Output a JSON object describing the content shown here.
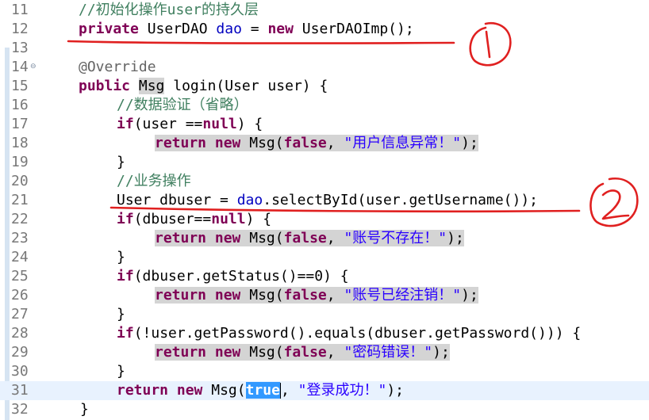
{
  "editor": {
    "lines": [
      {
        "num": "11",
        "segments": [
          {
            "t": "//初始化操作user的持久层",
            "c": "cm"
          }
        ]
      },
      {
        "num": "12",
        "segments": [
          {
            "t": "private",
            "c": "kw"
          },
          {
            "t": " UserDAO ",
            "c": ""
          },
          {
            "t": "dao",
            "c": "fd"
          },
          {
            "t": " = ",
            "c": ""
          },
          {
            "t": "new",
            "c": "kw"
          },
          {
            "t": " UserDAOImp();",
            "c": ""
          }
        ]
      },
      {
        "num": "13",
        "segments": []
      },
      {
        "num": "14",
        "fold": "⊖",
        "segments": [
          {
            "t": "@Override",
            "c": "an"
          }
        ]
      },
      {
        "num": "15",
        "segments": [
          {
            "t": "public",
            "c": "kw"
          },
          {
            "t": " ",
            "c": ""
          },
          {
            "t": "Msg",
            "c": "hl"
          },
          {
            "t": " login(User user) {",
            "c": ""
          }
        ]
      },
      {
        "num": "16",
        "segments": [
          {
            "t": "//数据验证（省略）",
            "c": "cm"
          }
        ]
      },
      {
        "num": "17",
        "segments": [
          {
            "t": "if",
            "c": "kw"
          },
          {
            "t": "(user ==",
            "c": ""
          },
          {
            "t": "null",
            "c": "kw"
          },
          {
            "t": ") {",
            "c": ""
          }
        ]
      },
      {
        "num": "18",
        "segments": [
          {
            "t": "return",
            "c": "kw hl"
          },
          {
            "t": " ",
            "c": "hl"
          },
          {
            "t": "new",
            "c": "kw hl"
          },
          {
            "t": " Msg(",
            "c": "hl"
          },
          {
            "t": "false",
            "c": "kw hl"
          },
          {
            "t": ", ",
            "c": "hl"
          },
          {
            "t": "\"用户信息异常！\"",
            "c": "st hl"
          },
          {
            "t": ");",
            "c": "hl"
          }
        ]
      },
      {
        "num": "19",
        "segments": [
          {
            "t": "}",
            "c": ""
          }
        ]
      },
      {
        "num": "20",
        "segments": [
          {
            "t": "//业务操作",
            "c": "cm"
          }
        ]
      },
      {
        "num": "21",
        "segments": [
          {
            "t": "User dbuser = ",
            "c": ""
          },
          {
            "t": "dao",
            "c": "fd"
          },
          {
            "t": ".selectById(user.getUsername());",
            "c": ""
          }
        ]
      },
      {
        "num": "22",
        "segments": [
          {
            "t": "if",
            "c": "kw"
          },
          {
            "t": "(dbuser==",
            "c": ""
          },
          {
            "t": "null",
            "c": "kw"
          },
          {
            "t": ") {",
            "c": ""
          }
        ]
      },
      {
        "num": "23",
        "segments": [
          {
            "t": "return",
            "c": "kw hl"
          },
          {
            "t": " ",
            "c": "hl"
          },
          {
            "t": "new",
            "c": "kw hl"
          },
          {
            "t": " Msg(",
            "c": "hl"
          },
          {
            "t": "false",
            "c": "kw hl"
          },
          {
            "t": ", ",
            "c": "hl"
          },
          {
            "t": "\"账号不存在！\"",
            "c": "st hl"
          },
          {
            "t": ");",
            "c": "hl"
          }
        ]
      },
      {
        "num": "24",
        "segments": [
          {
            "t": "}",
            "c": ""
          }
        ]
      },
      {
        "num": "25",
        "segments": [
          {
            "t": "if",
            "c": "kw"
          },
          {
            "t": "(dbuser.getStatus()==0) {",
            "c": ""
          }
        ]
      },
      {
        "num": "26",
        "segments": [
          {
            "t": "return",
            "c": "kw hl"
          },
          {
            "t": " ",
            "c": "hl"
          },
          {
            "t": "new",
            "c": "kw hl"
          },
          {
            "t": " Msg(",
            "c": "hl"
          },
          {
            "t": "false",
            "c": "kw hl"
          },
          {
            "t": ", ",
            "c": "hl"
          },
          {
            "t": "\"账号已经注销！\"",
            "c": "st hl"
          },
          {
            "t": ");",
            "c": "hl"
          }
        ]
      },
      {
        "num": "27",
        "segments": [
          {
            "t": "}",
            "c": ""
          }
        ]
      },
      {
        "num": "28",
        "segments": [
          {
            "t": "if",
            "c": "kw"
          },
          {
            "t": "(!user.getPassword().equals(dbuser.getPassword())) {",
            "c": ""
          }
        ]
      },
      {
        "num": "29",
        "segments": [
          {
            "t": "return",
            "c": "kw hl"
          },
          {
            "t": " ",
            "c": "hl"
          },
          {
            "t": "new",
            "c": "kw hl"
          },
          {
            "t": " Msg(",
            "c": "hl"
          },
          {
            "t": "false",
            "c": "kw hl"
          },
          {
            "t": ", ",
            "c": "hl"
          },
          {
            "t": "\"密码错误！\"",
            "c": "st hl"
          },
          {
            "t": ");",
            "c": "hl"
          }
        ]
      },
      {
        "num": "30",
        "segments": [
          {
            "t": "}",
            "c": ""
          }
        ]
      },
      {
        "num": "31",
        "current": true,
        "segments": [
          {
            "t": "return",
            "c": "kw"
          },
          {
            "t": " ",
            "c": ""
          },
          {
            "t": "new",
            "c": "kw"
          },
          {
            "t": " Msg(",
            "c": ""
          },
          {
            "t": "true",
            "c": "kw sel"
          },
          {
            "t": "|",
            "c": "caret"
          },
          {
            "t": ", ",
            "c": ""
          },
          {
            "t": "\"登录成功！\"",
            "c": "st"
          },
          {
            "t": ");",
            "c": ""
          }
        ]
      },
      {
        "num": "32",
        "segments": [
          {
            "t": "}",
            "c": ""
          }
        ]
      }
    ]
  },
  "annotations": {
    "circle_1_label": "1",
    "circle_2_label": "2",
    "ink_color": "#e02020"
  },
  "colors": {
    "keyword": "#7f0055",
    "comment": "#3f7f5f",
    "string": "#2a00ff",
    "field": "#0000c0",
    "annotation": "#646464",
    "current_line": "#e8f2fe",
    "selection": "#3399ff"
  }
}
